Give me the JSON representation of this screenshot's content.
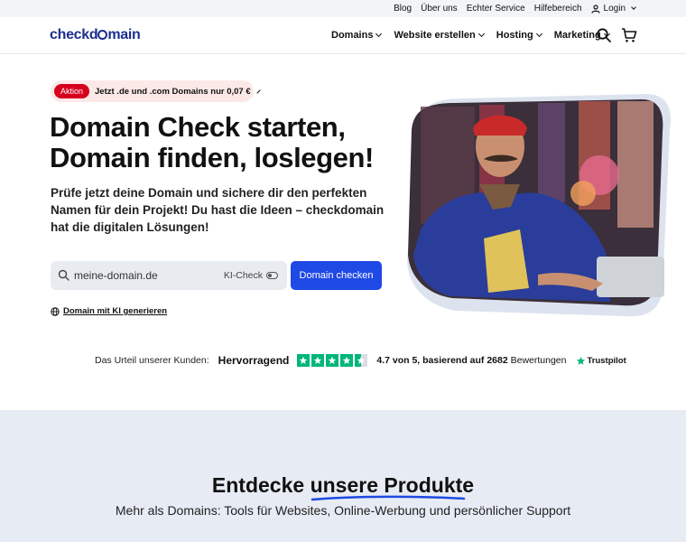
{
  "topbar": {
    "links": [
      "Blog",
      "Über uns",
      "Echter Service",
      "Hilfebereich"
    ],
    "login": "Login"
  },
  "brand": {
    "logo_pre": "checkd",
    "logo_post": "main",
    "accent": "#1f49e4"
  },
  "nav": {
    "items": [
      {
        "label": "Domains"
      },
      {
        "label": "Website erstellen"
      },
      {
        "label": "Hosting"
      },
      {
        "label": "Marketing"
      }
    ],
    "icons": [
      "search-icon",
      "cart-icon"
    ]
  },
  "promo": {
    "badge": "Aktion",
    "text": "Jetzt .de und .com Domains nur 0,07 €"
  },
  "hero": {
    "headline_1": "Domain Check starten,",
    "headline_2": "Domain finden, loslegen!",
    "lead": "Prüfe jetzt deine Domain und sichere dir den perfekten Namen für dein Projekt! Du hast die Ideen – checkdomain hat die digitalen Lösungen!"
  },
  "search": {
    "placeholder": "meine-domain.de",
    "ki_label": "KI-Check",
    "button": "Domain checken",
    "ai_link": "Domain mit KI generieren"
  },
  "trust": {
    "label": "Das Urteil unserer Kunden:",
    "rating_word": "Hervorragend",
    "stars": 4.5,
    "score_pre": "4.7 von 5, basierend auf",
    "review_count": "2682",
    "score_post": "Bewertungen",
    "provider": "Trustpilot"
  },
  "products": {
    "title_pre": "Entdecke",
    "title_highlight": "unsere Produkte",
    "subtitle": "Mehr als Domains: Tools für Websites, Online-Werbung und persönlicher Support"
  }
}
